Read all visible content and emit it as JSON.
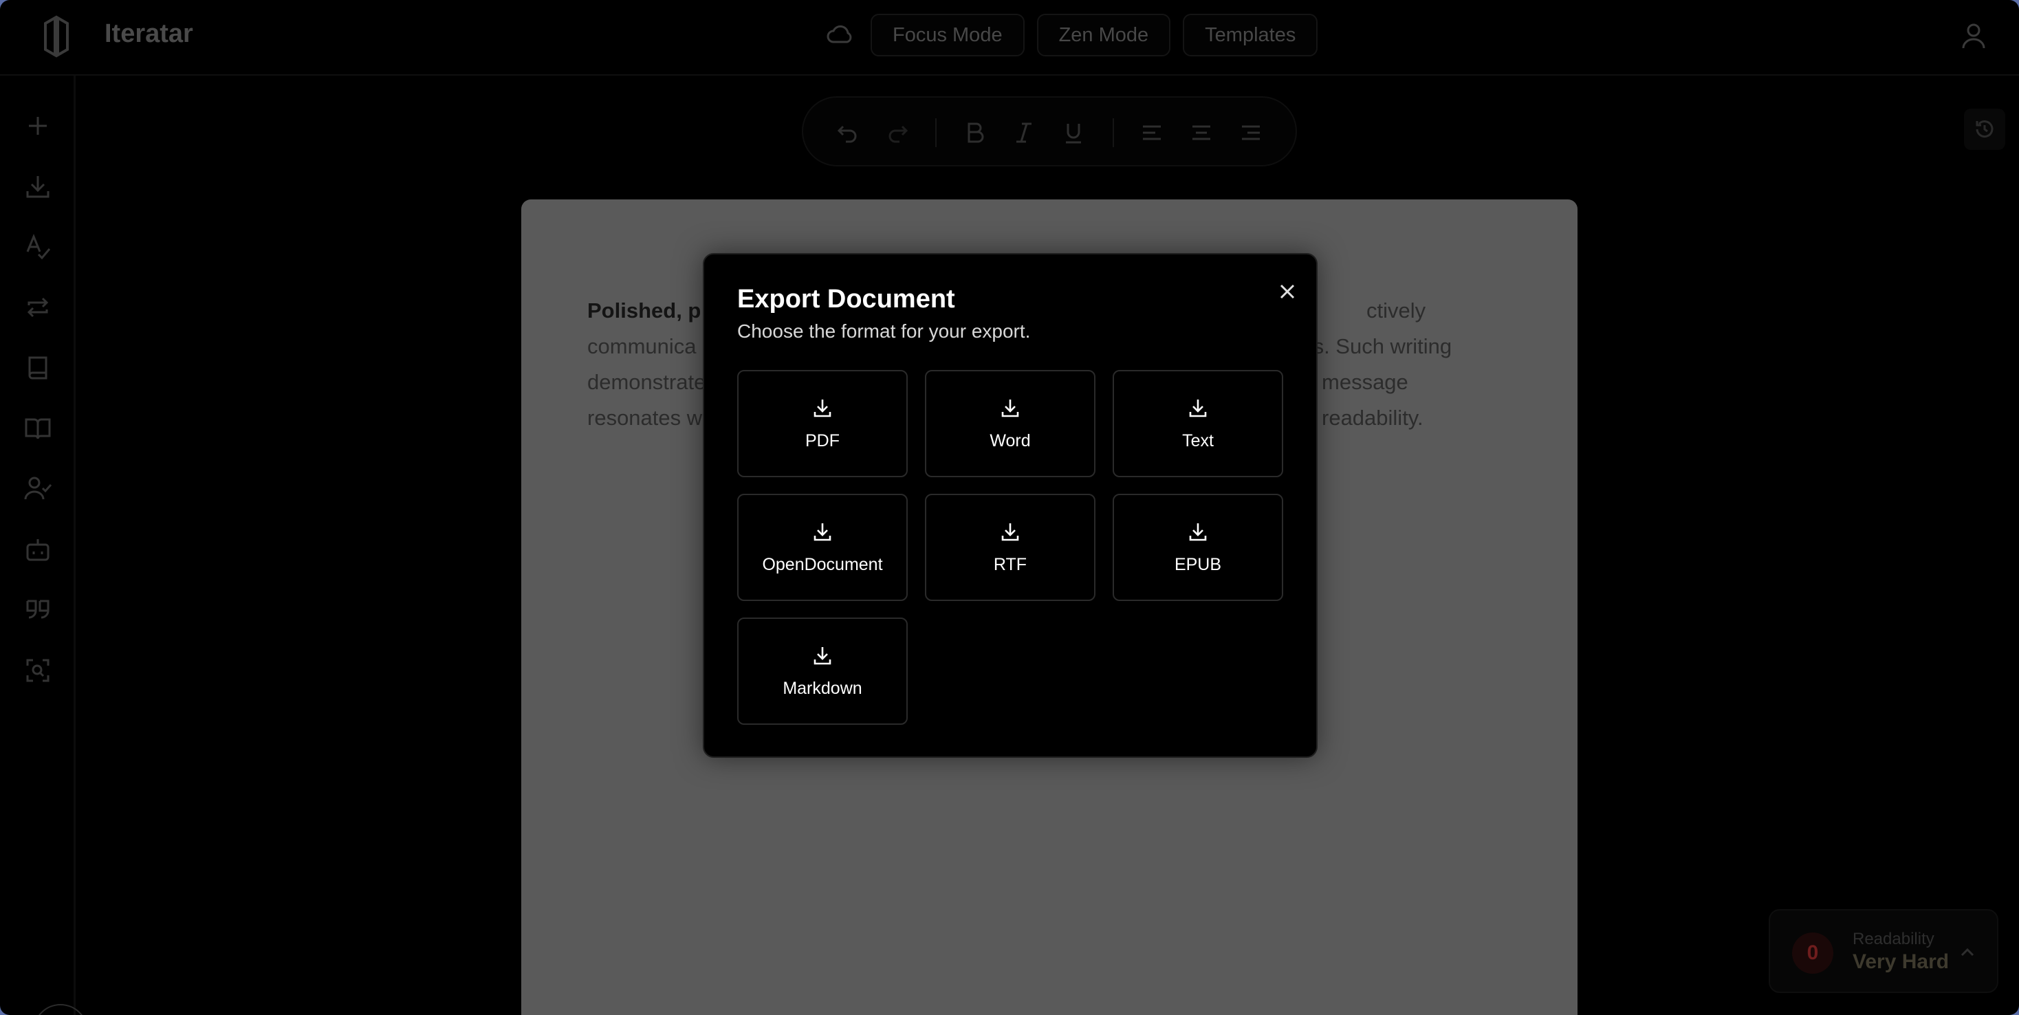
{
  "header": {
    "app_title": "Iteratar",
    "buttons": [
      "Focus Mode",
      "Zen Mode",
      "Templates"
    ]
  },
  "sidebar": {
    "icons": [
      "plus-icon",
      "download-icon",
      "spellcheck-icon",
      "arrows-repeat-icon",
      "book-icon",
      "open-book-icon",
      "user-check-icon",
      "bot-icon",
      "quote-icon",
      "scan-search-icon"
    ],
    "search_icon": "search-icon"
  },
  "toolbar": {
    "icons": [
      "undo-icon",
      "redo-icon",
      "bold-icon",
      "italic-icon",
      "underline-icon",
      "align-left-icon",
      "align-center-icon",
      "align-right-icon"
    ]
  },
  "document": {
    "bold_fragment": "Polished, p",
    "lines": [
      {
        "left": "communica",
        "right": "ors. Such writing"
      },
      {
        "left": "demonstrate",
        "right": "message"
      },
      {
        "left": "resonates w",
        "right": "readability."
      }
    ],
    "line1_right": "ctively"
  },
  "readability": {
    "score": "0",
    "label": "Readability",
    "value": "Very Hard"
  },
  "modal": {
    "title": "Export Document",
    "subtitle": "Choose the format for your export.",
    "formats": [
      "PDF",
      "Word",
      "Text",
      "OpenDocument",
      "RTF",
      "EPUB",
      "Markdown"
    ]
  },
  "colors": {
    "background": "#000000",
    "document_overlay": "#5a5a5a",
    "score_red": "#6e1d1d"
  }
}
